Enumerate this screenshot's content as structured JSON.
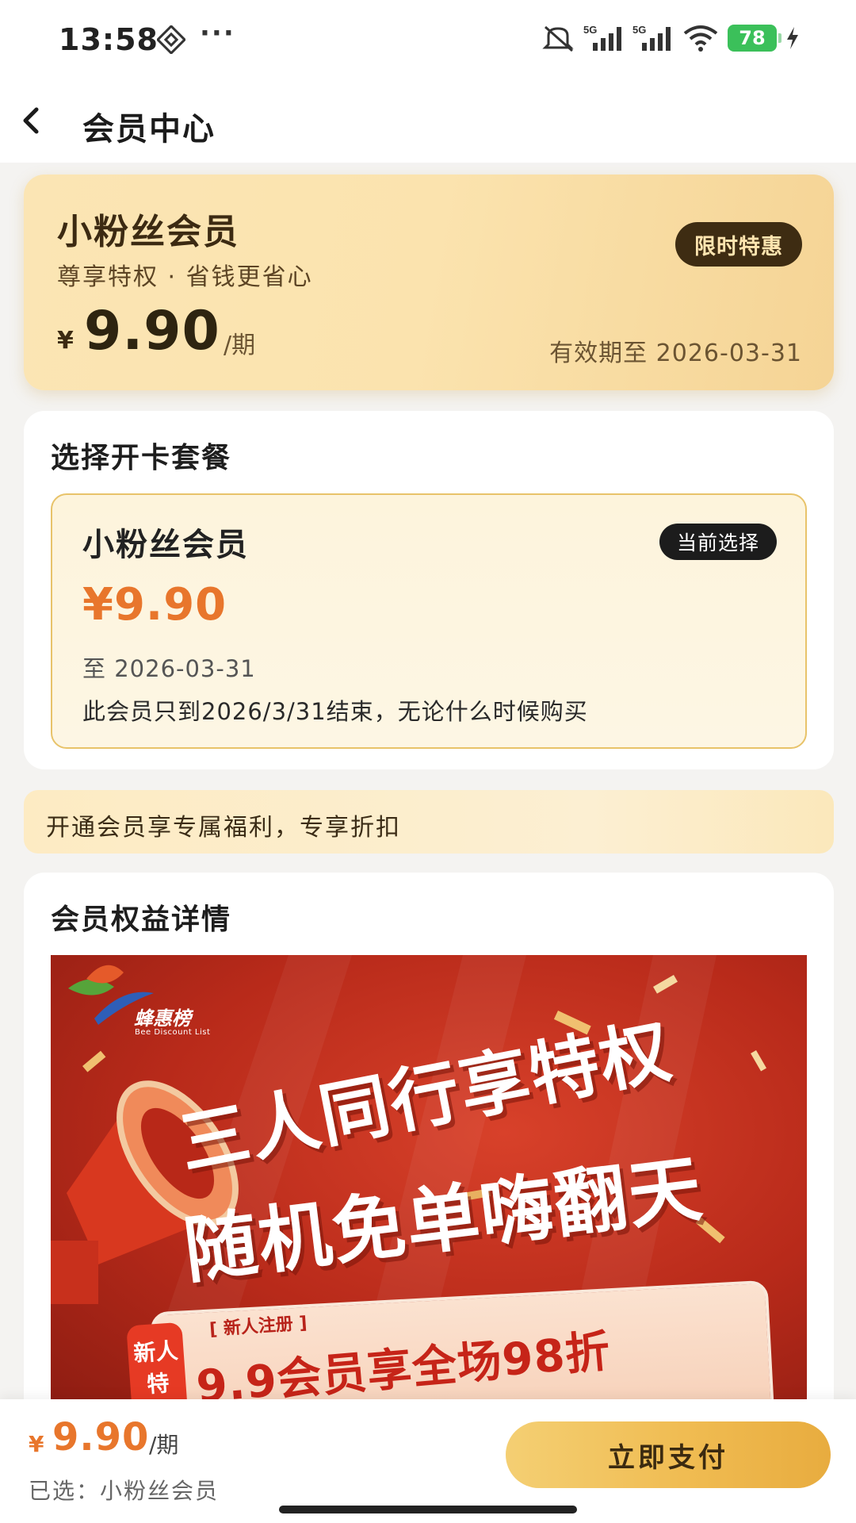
{
  "status_bar": {
    "time": "13:58",
    "dots": "···",
    "network_1": "5G",
    "network_2": "5G",
    "battery": "78",
    "icons": [
      "nfc-icon",
      "mute-icon",
      "signal-icon",
      "wifi-icon",
      "battery-icon",
      "charging-icon"
    ]
  },
  "header": {
    "title": "会员中心"
  },
  "hero": {
    "title": "小粉丝会员",
    "subtitle": "尊享特权 · 省钱更省心",
    "currency": "¥",
    "price": "9.90",
    "unit": "/期",
    "badge": "限时特惠",
    "validity": "有效期至 2026-03-31"
  },
  "package_section": {
    "title": "选择开卡套餐",
    "package": {
      "name": "小粉丝会员",
      "badge": "当前选择",
      "price": "¥9.90",
      "until": "至 2026-03-31",
      "note": "此会员只到2026/3/31结束，无论什么时候购买"
    }
  },
  "benefit_strip": {
    "text": "开通会员享专属福利，专享折扣"
  },
  "details_section": {
    "title": "会员权益详情",
    "poster": {
      "logo_name": "蜂惠榜",
      "logo_sub": "Bee Discount List",
      "headline_1": "三人同行享特权",
      "headline_2": "随机免单嗨翻天",
      "tag": "[ 新人注册 ]",
      "promo": "9.9会员享全场98折",
      "side_label": "新人特"
    }
  },
  "bottom_bar": {
    "currency": "¥",
    "price": "9.90",
    "unit": "/期",
    "selected": "已选：小粉丝会员",
    "pay_button": "立即支付"
  },
  "colors": {
    "accent_orange": "#e8762c",
    "gold": "#f0bc52",
    "dark_brown": "#3e2c12"
  }
}
